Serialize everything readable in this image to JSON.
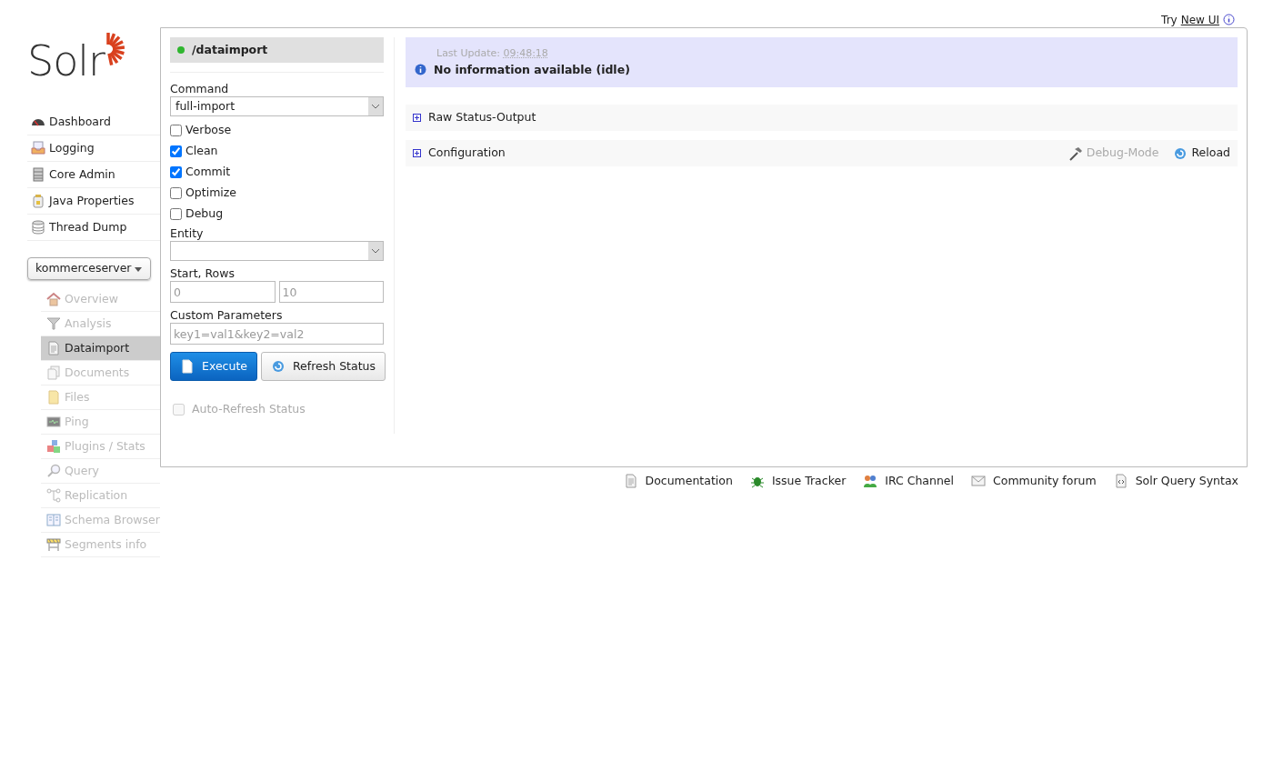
{
  "top_link": {
    "prefix": "Try",
    "link": "New UI"
  },
  "logo": {
    "text": "Solr"
  },
  "main_nav": [
    {
      "label": "Dashboard"
    },
    {
      "label": "Logging"
    },
    {
      "label": "Core Admin"
    },
    {
      "label": "Java Properties"
    },
    {
      "label": "Thread Dump"
    }
  ],
  "core_selector": {
    "value": "kommerceserver"
  },
  "core_nav": [
    {
      "label": "Overview",
      "selected": false
    },
    {
      "label": "Analysis",
      "selected": false
    },
    {
      "label": "Dataimport",
      "selected": true
    },
    {
      "label": "Documents",
      "selected": false
    },
    {
      "label": "Files",
      "selected": false
    },
    {
      "label": "Ping",
      "selected": false
    },
    {
      "label": "Plugins / Stats",
      "selected": false
    },
    {
      "label": "Query",
      "selected": false
    },
    {
      "label": "Replication",
      "selected": false
    },
    {
      "label": "Schema Browser",
      "selected": false
    },
    {
      "label": "Segments info",
      "selected": false
    }
  ],
  "handler": {
    "name": "/dataimport",
    "color": "#2fb62f"
  },
  "form": {
    "command_label": "Command",
    "command_value": "full-import",
    "options": [
      {
        "label": "Verbose",
        "checked": false
      },
      {
        "label": "Clean",
        "checked": true
      },
      {
        "label": "Commit",
        "checked": true
      },
      {
        "label": "Optimize",
        "checked": false
      },
      {
        "label": "Debug",
        "checked": false
      }
    ],
    "entity_label": "Entity",
    "start_rows_label": "Start, Rows",
    "start_placeholder": "0",
    "rows_placeholder": "10",
    "custom_label": "Custom Parameters",
    "custom_placeholder": "key1=val1&key2=val2",
    "execute": "Execute",
    "refresh": "Refresh Status",
    "auto_refresh": {
      "label": "Auto-Refresh Status",
      "checked": false,
      "disabled": true
    }
  },
  "status": {
    "last_update_label": "Last Update:",
    "last_update_time": "09:48:18",
    "message": "No information available (idle)"
  },
  "sections": [
    {
      "title": "Raw Status-Output",
      "expanded": false
    },
    {
      "title": "Configuration",
      "expanded": false,
      "actions": [
        {
          "label": "Debug-Mode",
          "disabled": true
        },
        {
          "label": "Reload",
          "disabled": false
        }
      ]
    }
  ],
  "footer_links": [
    "Documentation",
    "Issue Tracker",
    "IRC Channel",
    "Community forum",
    "Solr Query Syntax"
  ]
}
